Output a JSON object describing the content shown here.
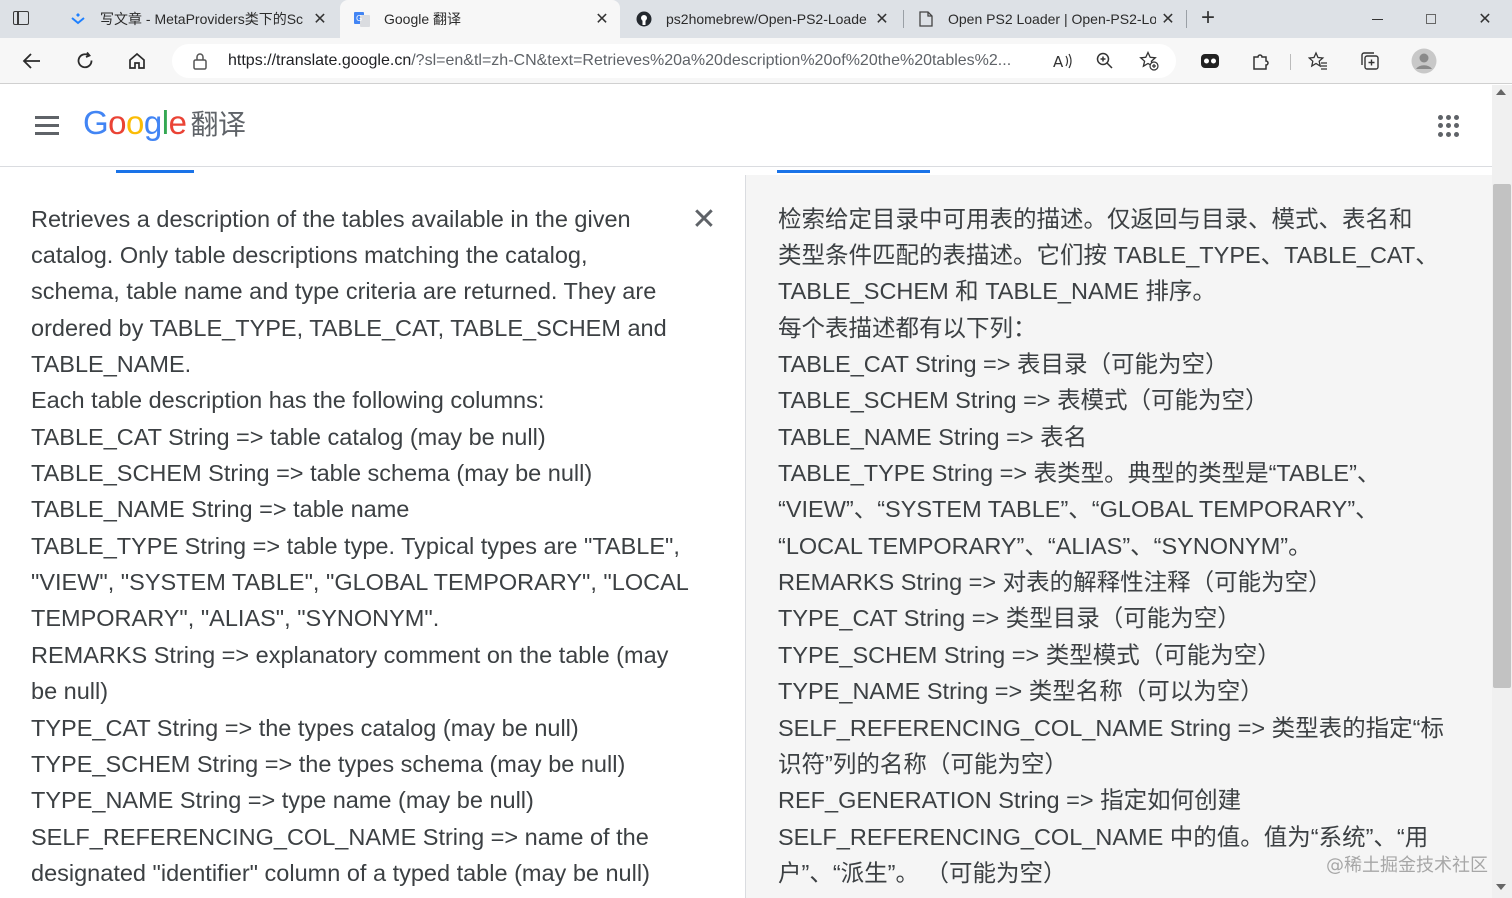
{
  "browser": {
    "tabs": [
      {
        "title": "写文章 - MetaProviders类下的Sc",
        "icon": "juejin-icon",
        "active": false
      },
      {
        "title": "Google 翻译",
        "icon": "google-translate-icon",
        "active": true
      },
      {
        "title": "ps2homebrew/Open-PS2-Loade",
        "icon": "github-icon",
        "active": false
      },
      {
        "title": "Open PS2 Loader | Open-PS2-Lo",
        "icon": "page-icon",
        "active": false
      }
    ],
    "tab_close_symbol": "✕",
    "new_tab_symbol": "+",
    "url_host": "https://translate.google.cn",
    "url_rest": "/?sl=en&tl=zh-CN&text=Retrieves%20a%20description%20of%20the%20tables%2..."
  },
  "header": {
    "logo_letters": [
      "G",
      "o",
      "o",
      "g",
      "l",
      "e"
    ],
    "product": "翻译"
  },
  "source": {
    "clear_symbol": "✕",
    "lines": [
      "Retrieves a description of the tables available in the given",
      "catalog. Only table descriptions matching the catalog,",
      "schema, table name and type criteria are returned. They are",
      "ordered by TABLE_TYPE, TABLE_CAT, TABLE_SCHEM and",
      "TABLE_NAME.",
      "Each table description has the following columns:",
      "TABLE_CAT String => table catalog (may be null)",
      "TABLE_SCHEM String => table schema (may be null)",
      "TABLE_NAME String => table name",
      "TABLE_TYPE String => table type. Typical types are \"TABLE\",",
      "\"VIEW\", \"SYSTEM TABLE\", \"GLOBAL TEMPORARY\", \"LOCAL",
      "TEMPORARY\", \"ALIAS\", \"SYNONYM\".",
      "REMARKS String => explanatory comment on the table (may",
      "be null)",
      "TYPE_CAT String => the types catalog (may be null)",
      "TYPE_SCHEM String => the types schema (may be null)",
      "TYPE_NAME String => type name (may be null)",
      "SELF_REFERENCING_COL_NAME String => name of the",
      "designated \"identifier\" column of a typed table (may be null)"
    ]
  },
  "translation": {
    "lines": [
      "检索给定目录中可用表的描述。仅返回与目录、模式、表名和",
      "类型条件匹配的表描述。它们按 TABLE_TYPE、TABLE_CAT、",
      "TABLE_SCHEM 和 TABLE_NAME 排序。",
      "每个表描述都有以下列：",
      "TABLE_CAT String => 表目录（可能为空）",
      "TABLE_SCHEM String => 表模式（可能为空）",
      "TABLE_NAME String => 表名",
      "TABLE_TYPE String => 表类型。典型的类型是“TABLE”、",
      "“VIEW”、“SYSTEM TABLE”、“GLOBAL TEMPORARY”、",
      "“LOCAL TEMPORARY”、“ALIAS”、“SYNONYM”。",
      "REMARKS String => 对表的解释性注释（可能为空）",
      "TYPE_CAT String => 类型目录（可能为空）",
      "TYPE_SCHEM String => 类型模式（可能为空）",
      "TYPE_NAME String => 类型名称（可以为空）",
      "SELF_REFERENCING_COL_NAME String => 类型表的指定“标",
      "识符”列的名称（可能为空）",
      "REF_GENERATION String => 指定如何创建",
      "SELF_REFERENCING_COL_NAME 中的值。值为“系统”、“用",
      "户”、“派生”。 （可能为空）"
    ]
  },
  "watermark": "@稀土掘金技术社区",
  "colors": {
    "accent": "#1a73e8",
    "google_blue": "#4285f4",
    "google_red": "#ea4335",
    "google_yellow": "#fbbc05",
    "google_green": "#34a853"
  }
}
